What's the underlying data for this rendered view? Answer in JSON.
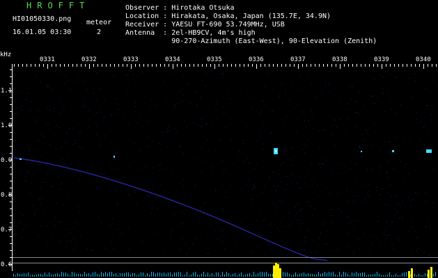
{
  "app": {
    "brand": "HROFFT",
    "filename": "HI01050330.png",
    "datetime": "16.01.05 03:30",
    "meteor_label": "meteor",
    "meteor_count": "2"
  },
  "station": {
    "observer": "Observer : Hirotaka Otsuka",
    "location": "Location : Hirakata, Osaka, Japan (135.7E, 34.9N)",
    "receiver": "Receiver : YAESU FT-690 53.749MHz, USB",
    "antenna": "Antenna  : 2el-HB9CV, 4m's high",
    "antenna2": "           90-270-Azimuth (East-West), 90-Elevation (Zenith)"
  },
  "axes": {
    "freq_unit": "kHz",
    "freq_ticks": [
      "1.1",
      "1.0",
      "0.9",
      "0.8",
      "0.7",
      "0.6"
    ],
    "time_ticks": [
      "0331",
      "0332",
      "0333",
      "0334",
      "0335",
      "0336",
      "0337",
      "0338",
      "0339",
      "0340"
    ]
  },
  "colors": {
    "background": "#000000",
    "text": "#ffffff",
    "brand": "#55dd55",
    "noise": "#1a1a6e",
    "trace": "#2a2ab0",
    "meteor": "#3fe0ff",
    "meteor_core": "#ffffff",
    "baseline": "#888888",
    "spectrum_low": "#00b8ff",
    "spectrum_peak": "#ffee00"
  }
}
